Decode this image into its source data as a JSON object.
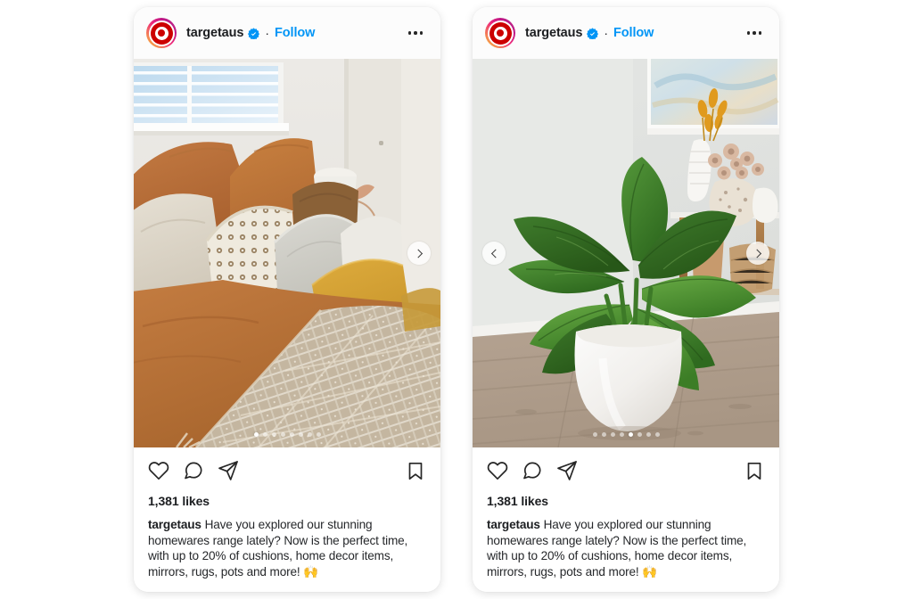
{
  "background_color": "#ffffff",
  "accent_colors": {
    "follow_link": "#0095f6",
    "verified_badge": "#0095f6",
    "brand_red": "#cc0000",
    "text_primary": "#1c1e21"
  },
  "posts": [
    {
      "id": "post-left",
      "header": {
        "avatar_name": "targetaus-avatar",
        "username": "targetaus",
        "verified_icon": "verified-badge-icon",
        "separator": "·",
        "follow_label": "Follow",
        "more_options_icon": "more-options-icon"
      },
      "media": {
        "alt": "bedroom with rust linen bedding, cushions and woven throw",
        "prev_icon": "chevron-left-icon",
        "next_icon": "chevron-right-icon",
        "show_prev": false,
        "show_next": true,
        "dots_total": 8,
        "dots_active_index": 1
      },
      "actions": {
        "like_icon": "heart-icon",
        "comment_icon": "comment-icon",
        "share_icon": "share-icon",
        "save_icon": "bookmark-icon"
      },
      "likes": "1,381 likes",
      "caption": {
        "user": "targetaus",
        "text": "Have you explored our stunning homewares range lately? Now is the perfect time, with up to 20% of cushions, home decor items, mirrors, rugs, pots and more!",
        "emoji": "🙌"
      }
    },
    {
      "id": "post-right",
      "header": {
        "avatar_name": "targetaus-avatar",
        "username": "targetaus",
        "verified_icon": "verified-badge-icon",
        "separator": "·",
        "follow_label": "Follow",
        "more_options_icon": "more-options-icon"
      },
      "media": {
        "alt": "large green philodendron plant in white ceramic pot on timber floor",
        "prev_icon": "chevron-left-icon",
        "next_icon": "chevron-right-icon",
        "show_prev": true,
        "show_next": true,
        "dots_total": 8,
        "dots_active_index": 5
      },
      "actions": {
        "like_icon": "heart-icon",
        "comment_icon": "comment-icon",
        "share_icon": "share-icon",
        "save_icon": "bookmark-icon"
      },
      "likes": "1,381 likes",
      "caption": {
        "user": "targetaus",
        "text": "Have you explored our stunning homewares range lately? Now is the perfect time, with up to 20% of cushions, home decor items, mirrors, rugs, pots and more!",
        "emoji": "🙌"
      }
    }
  ]
}
